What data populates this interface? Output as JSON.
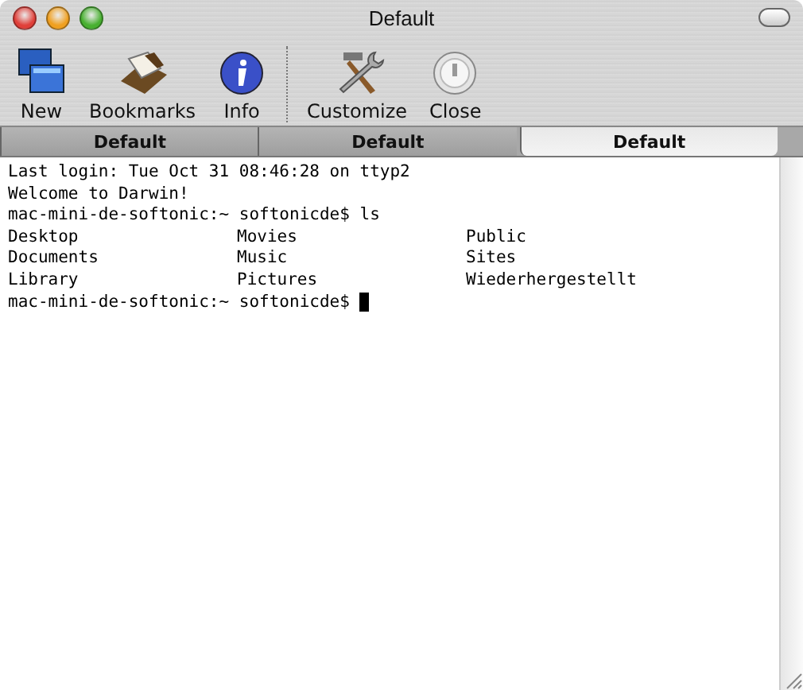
{
  "window": {
    "title": "Default"
  },
  "toolbar": {
    "groups": [
      [
        {
          "label": "New",
          "kind": "new"
        },
        {
          "label": "Bookmarks",
          "kind": "bookmarks"
        },
        {
          "label": "Info",
          "kind": "info"
        }
      ],
      [
        {
          "label": "Customize",
          "kind": "customize"
        },
        {
          "label": "Close",
          "kind": "close"
        }
      ]
    ]
  },
  "tabs": [
    {
      "label": "Default",
      "selected": false
    },
    {
      "label": "Default",
      "selected": false
    },
    {
      "label": "Default",
      "selected": true
    }
  ],
  "terminal": {
    "lines": [
      {
        "kind": "text",
        "text": "Last login: Tue Oct 31 08:46:28 on ttyp2"
      },
      {
        "kind": "text",
        "text": "Welcome to Darwin!"
      },
      {
        "kind": "text",
        "text": "mac-mini-de-softonic:~ softonicde$ ls"
      },
      {
        "kind": "columns",
        "cells": [
          "Desktop",
          "Movies",
          "Public"
        ]
      },
      {
        "kind": "columns",
        "cells": [
          "Documents",
          "Music",
          "Sites"
        ]
      },
      {
        "kind": "columns",
        "cells": [
          "Library",
          "Pictures",
          "Wiederhergestellt"
        ]
      },
      {
        "kind": "prompt",
        "text": "mac-mini-de-softonic:~ softonicde$"
      }
    ]
  }
}
